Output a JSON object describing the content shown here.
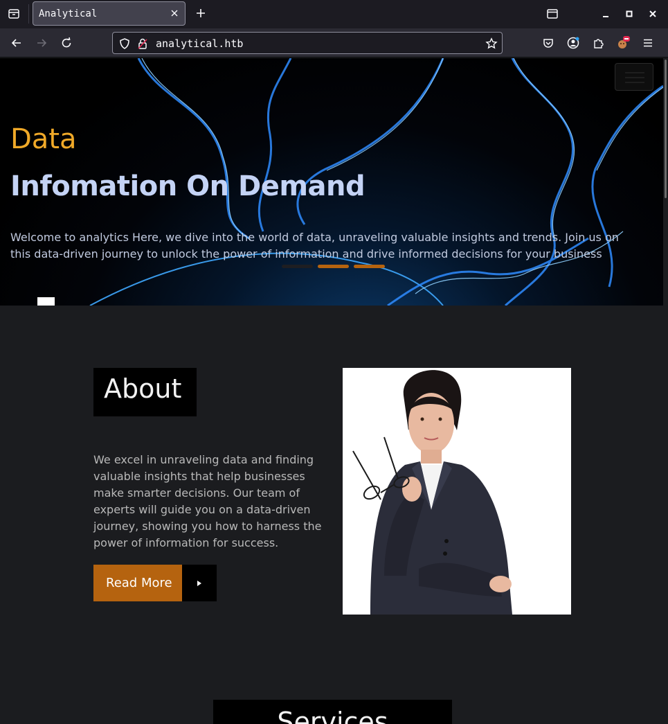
{
  "browser": {
    "tab_title": "Analytical",
    "url": "analytical.htb"
  },
  "hero": {
    "kicker": "Data",
    "title": "Infomation On Demand",
    "text": "Welcome to analytics Here, we dive into the world of data, unraveling valuable insights and trends. Join us on this data-driven journey to unlock the power of information and drive informed decisions for your business",
    "indicators": [
      {
        "active": true,
        "color": "#1e1e22"
      },
      {
        "active": false,
        "color": "#b5630f"
      },
      {
        "active": false,
        "color": "#b5630f"
      }
    ]
  },
  "about": {
    "heading": "About",
    "text": "We excel in unraveling data and finding valuable insights that help businesses make smarter decisions. Our team of experts will guide you on a data-driven journey, showing you how to harness the power of information for success.",
    "button_label": "Read More"
  },
  "services": {
    "heading": "Services"
  },
  "colors": {
    "accent": "#b5630f",
    "kicker": "#f0a928",
    "title": "#c4d3f5",
    "page_bg": "#1b1c1f"
  }
}
